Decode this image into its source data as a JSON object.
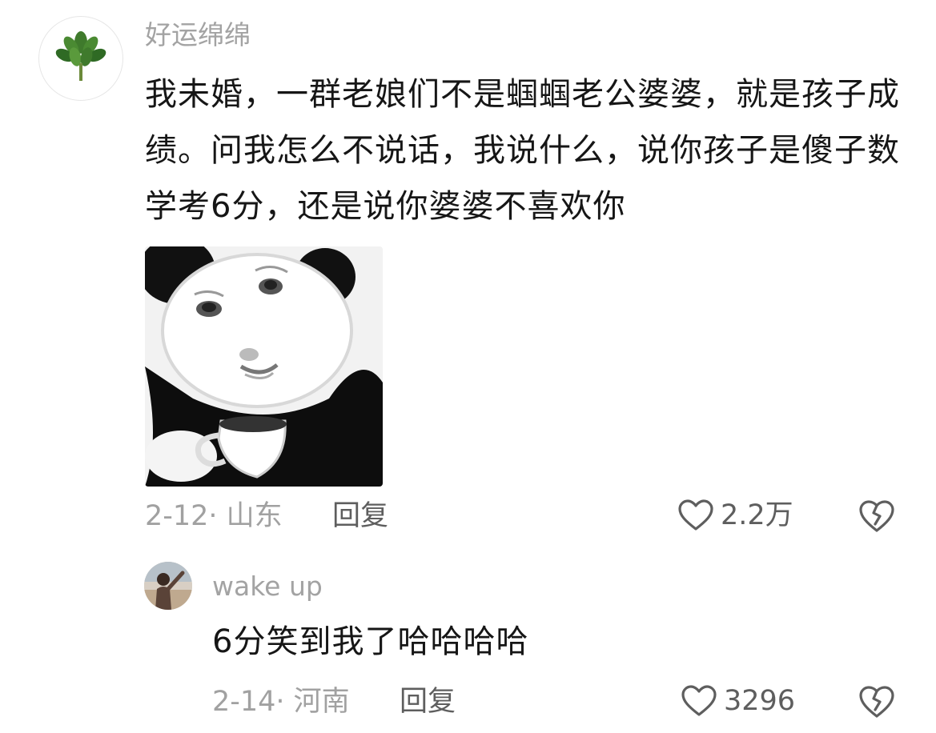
{
  "comment": {
    "username": "好运绵绵",
    "text": "我未婚，一群老娘们不是蝈蝈老公婆婆，就是孩子成绩。问我怎么不说话，我说什么，说你孩子是傻子数学考6分，还是说你婆婆不喜欢你",
    "date_location": "2-12· 山东",
    "reply_label": "回复",
    "like_count": "2.2万"
  },
  "reply": {
    "username": "wake up",
    "text": "6分笑到我了哈哈哈哈",
    "date_location": "2-14· 河南",
    "reply_label": "回复",
    "like_count": "3296"
  },
  "icons": {
    "like": "heart-outline-icon",
    "dislike": "broken-heart-icon"
  },
  "colors": {
    "text_primary": "#161616",
    "text_secondary": "#a3a3a3",
    "action_gray": "#5e5e5e"
  }
}
